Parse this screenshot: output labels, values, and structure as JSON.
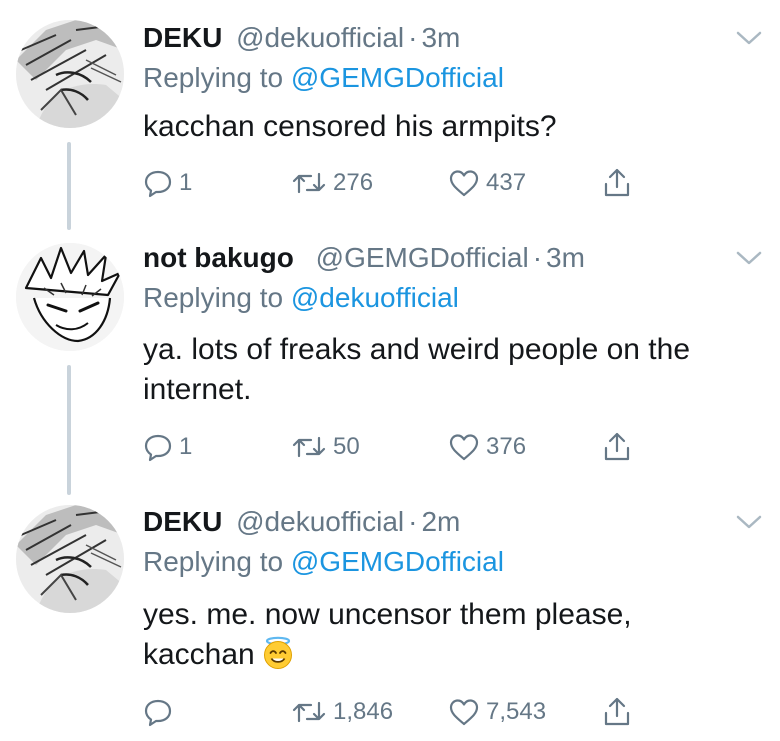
{
  "tweets": [
    {
      "name": "DEKU",
      "handle": "@dekuofficial",
      "separator": "·",
      "time": "3m",
      "replying_prefix": "Replying to",
      "replying_handle": "@GEMGDofficial",
      "text_line1": "kacchan censored his armpits?",
      "text_line2": "",
      "replies": "1",
      "retweets": "276",
      "likes": "437"
    },
    {
      "name": "not bakugo",
      "handle": "@GEMGDofficial",
      "separator": "·",
      "time": "3m",
      "replying_prefix": "Replying to",
      "replying_handle": "@dekuofficial",
      "text_line1": "ya. lots of freaks and weird people on the",
      "text_line2": "internet.",
      "replies": "1",
      "retweets": "50",
      "likes": "376"
    },
    {
      "name": "DEKU",
      "handle": "@dekuofficial",
      "separator": "·",
      "time": "2m",
      "replying_prefix": "Replying to",
      "replying_handle": "@GEMGDofficial",
      "text_line1": "yes. me. now uncensor them please,",
      "text_line2": "kacchan",
      "emoji": "smiling-face-with-halo",
      "replies": "",
      "retweets": "1,846",
      "likes": "7,543"
    }
  ],
  "colors": {
    "text": "#14171a",
    "secondary": "#657786",
    "link": "#1b95e0",
    "thread_line": "#c9d3db"
  },
  "icons": [
    "chevron-down-icon",
    "reply-icon",
    "retweet-icon",
    "like-icon",
    "share-icon"
  ]
}
